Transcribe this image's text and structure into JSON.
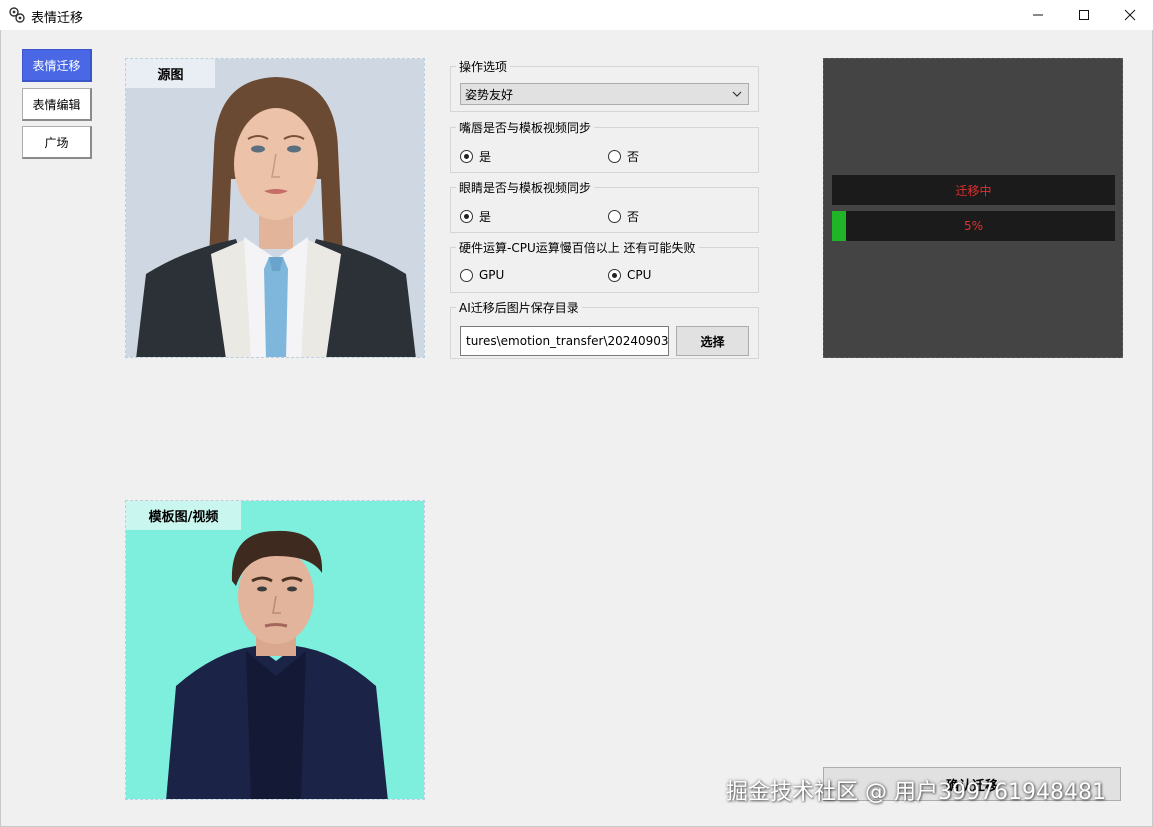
{
  "window": {
    "title": "表情迁移",
    "icon": "app-gears-icon",
    "controls": [
      "minimize-icon",
      "maximize-icon",
      "close-icon"
    ]
  },
  "nav": {
    "items": [
      {
        "label": "表情迁移",
        "active": true
      },
      {
        "label": "表情编辑",
        "active": false
      },
      {
        "label": "广场",
        "active": false
      }
    ]
  },
  "source_panel": {
    "label": "源图"
  },
  "template_panel": {
    "label": "模板图/视频"
  },
  "options": {
    "operation": {
      "title": "操作选项",
      "selected": "姿势友好"
    },
    "mouth_sync": {
      "title": "嘴唇是否与模板视频同步",
      "options": [
        {
          "label": "是",
          "checked": true
        },
        {
          "label": "否",
          "checked": false
        }
      ]
    },
    "eye_sync": {
      "title": "眼睛是否与模板视频同步",
      "options": [
        {
          "label": "是",
          "checked": true
        },
        {
          "label": "否",
          "checked": false
        }
      ]
    },
    "hardware": {
      "title": "硬件运算-CPU运算慢百倍以上 还有可能失败",
      "options": [
        {
          "label": "GPU",
          "checked": false
        },
        {
          "label": "CPU",
          "checked": true
        }
      ]
    },
    "save_dir": {
      "title": "AI迁移后图片保存目录",
      "value": "tures\\emotion_transfer\\20240903",
      "button": "选择"
    }
  },
  "status": {
    "text": "迁移中",
    "progress_label": "5%",
    "progress_fraction": 0.05,
    "text_color": "#e03030",
    "fill_color": "#1fb526"
  },
  "confirm_button": {
    "label": "确认迁移"
  },
  "watermark": "掘金技术社区 @ 用户39976194848​1"
}
